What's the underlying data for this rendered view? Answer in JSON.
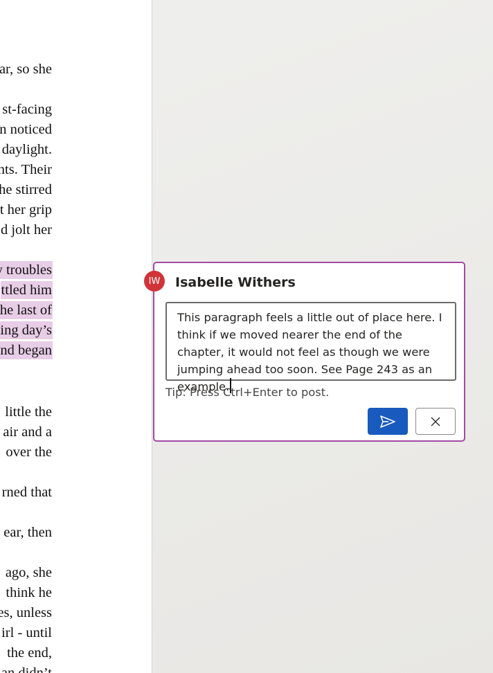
{
  "document": {
    "lines": [
      {
        "text": "ar, so she",
        "highlight": false
      },
      {
        "text": "st-facing",
        "highlight": false
      },
      {
        "text": "n noticed",
        "highlight": false
      },
      {
        "text": "daylight.",
        "highlight": false
      },
      {
        "text": "nts. Their",
        "highlight": false
      },
      {
        "text": "he stirred",
        "highlight": false
      },
      {
        "text": "t her grip",
        "highlight": false
      },
      {
        "text": "d jolt her",
        "highlight": false
      },
      {
        "text": "y troubles",
        "highlight": true
      },
      {
        "text": "ttled him",
        "highlight": true
      },
      {
        "text": "he last of",
        "highlight": true
      },
      {
        "text": "ing day’s",
        "highlight": true
      },
      {
        "text": "nd began",
        "highlight": true
      },
      {
        "text": "little the",
        "highlight": false
      },
      {
        "text": "air and a",
        "highlight": false
      },
      {
        "text": "over the",
        "highlight": false
      },
      {
        "text": "rned that",
        "highlight": false
      },
      {
        "text": "ear, then",
        "highlight": false
      },
      {
        "text": "ago, she",
        "highlight": false
      },
      {
        "text": "think he",
        "highlight": false
      },
      {
        "text": "es, unless",
        "highlight": false
      },
      {
        "text": "irl - until",
        "highlight": false
      },
      {
        "text": "the end,",
        "highlight": false
      },
      {
        "text": "an didn’t",
        "highlight": false
      }
    ]
  },
  "comment": {
    "avatar_initials": "IW",
    "author": "Isabelle Withers",
    "draft_text": "This paragraph feels a little out of place here. I think if we moved nearer the end of the chapter, it would not feel as though we were jumping ahead too soon. See Page 243 as an example.",
    "tip": "Tip: Press Ctrl+Enter to post.",
    "send_icon": "send-icon",
    "cancel_icon": "close-icon"
  },
  "colors": {
    "card_border": "#a349a4",
    "avatar_bg": "#d13438",
    "send_button": "#185abd",
    "highlight": "#e8cde6"
  }
}
